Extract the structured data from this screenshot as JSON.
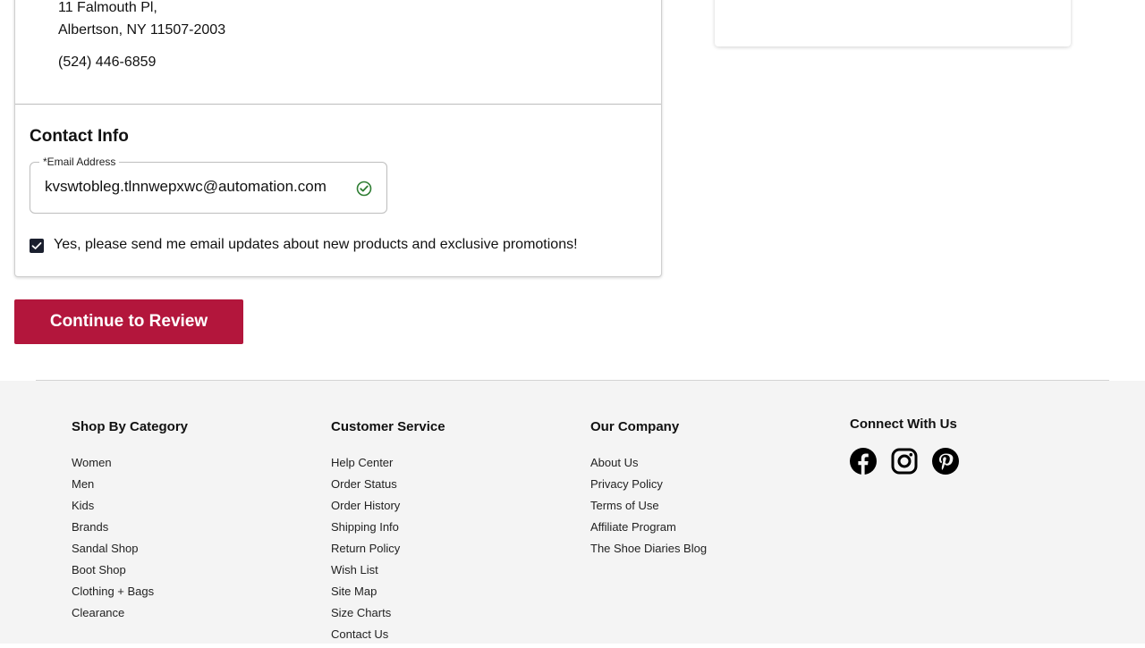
{
  "shipping": {
    "address_line1": "11 Falmouth Pl,",
    "address_line2": "Albertson, NY 11507-2003",
    "phone": "(524) 446-6859"
  },
  "contact": {
    "heading": "Contact Info",
    "email_label": "*Email Address",
    "email_value": "kvswtobleg.tlnnwepxwc@automation.com",
    "optin_checked": true,
    "optin_label": "Yes, please send me email updates about new products and exclusive promotions!"
  },
  "actions": {
    "continue_label": "Continue to Review"
  },
  "footer": {
    "shop": {
      "heading": "Shop By Category",
      "items": [
        "Women",
        "Men",
        "Kids",
        "Brands",
        "Sandal Shop",
        "Boot Shop",
        "Clothing + Bags",
        "Clearance"
      ]
    },
    "service": {
      "heading": "Customer Service",
      "items": [
        "Help Center",
        "Order Status",
        "Order History",
        "Shipping Info",
        "Return Policy",
        "Wish List",
        "Site Map",
        "Size Charts",
        "Contact Us"
      ]
    },
    "company": {
      "heading": "Our Company",
      "items": [
        "About Us",
        "Privacy Policy",
        "Terms of Use",
        "Affiliate Program",
        "The Shoe Diaries Blog"
      ]
    },
    "connect": {
      "heading": "Connect With Us",
      "icons": [
        "facebook-icon",
        "instagram-icon",
        "pinterest-icon"
      ]
    }
  },
  "colors": {
    "accent": "#b3163c",
    "valid": "#2e7d32",
    "footer_bg": "#f4f4f4"
  }
}
